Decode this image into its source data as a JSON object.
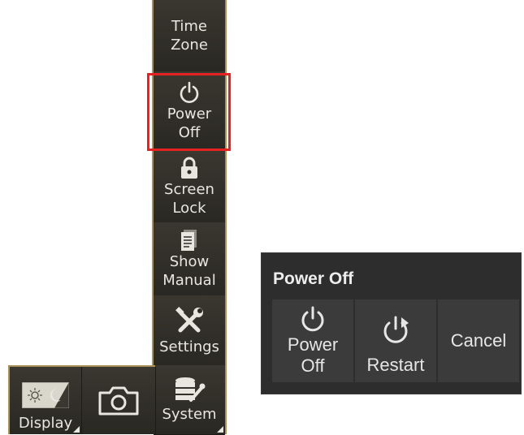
{
  "menu": {
    "items": [
      {
        "label": "Time\nZone",
        "icon": "clock-icon"
      },
      {
        "label": "Power\nOff",
        "icon": "power-icon"
      },
      {
        "label": "Screen\nLock",
        "icon": "lock-icon"
      },
      {
        "label": "Show\nManual",
        "icon": "manual-icon"
      },
      {
        "label": "Settings",
        "icon": "wrench-screwdriver-icon"
      },
      {
        "label": "System",
        "icon": "database-wrench-icon"
      }
    ],
    "highlighted_item": "Power Off",
    "highlight_color": "#e52122",
    "border_color": "#a8925a"
  },
  "bottom_bar": {
    "display_label": "Display",
    "display_icon": "sun-moon-icon",
    "camera_icon": "camera-icon"
  },
  "dialog": {
    "title": "Power Off",
    "buttons": [
      {
        "label": "Power\nOff",
        "icon": "power-icon"
      },
      {
        "label": "Restart",
        "icon": "restart-icon"
      },
      {
        "label": "Cancel"
      }
    ]
  }
}
